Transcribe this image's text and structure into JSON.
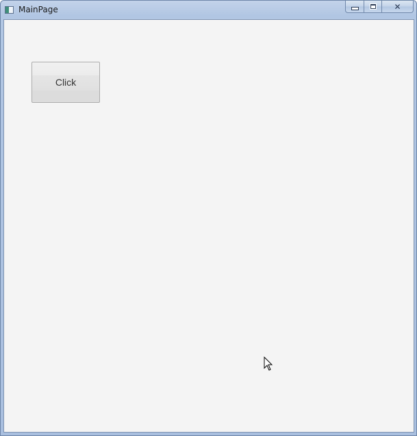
{
  "window": {
    "title": "MainPage"
  },
  "caption_buttons": {
    "minimize_icon": "minimize-icon",
    "maximize_icon": "maximize-icon",
    "close_icon": "close-icon",
    "close_glyph": "✕"
  },
  "main": {
    "click_button_label": "Click"
  },
  "colors": {
    "titlebar": "#b1c6e3",
    "client_background": "#f4f4f4",
    "button_border": "#acacac"
  }
}
